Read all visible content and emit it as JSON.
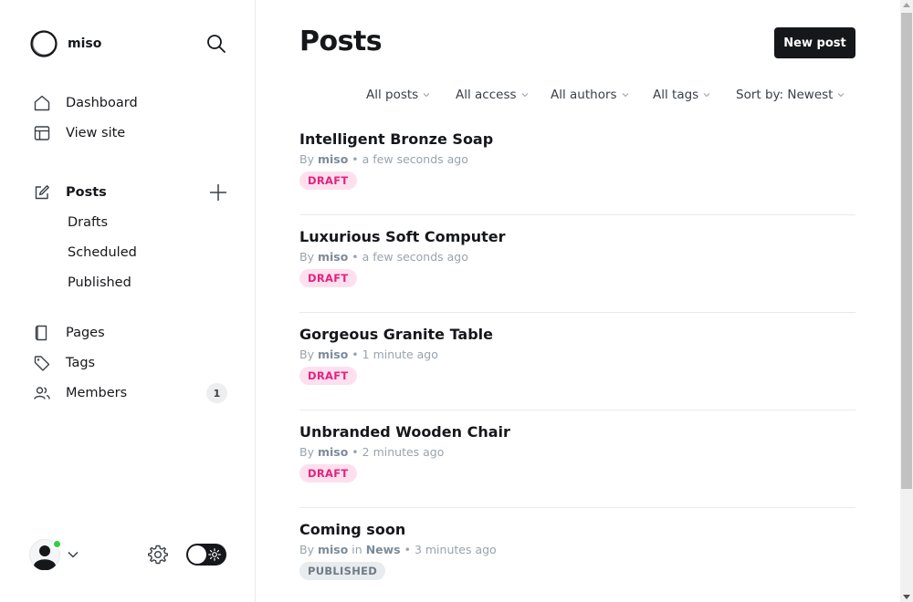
{
  "sidebar": {
    "brand_name": "miso",
    "nav": [
      {
        "label": "Dashboard",
        "icon": "house-icon"
      },
      {
        "label": "View site",
        "icon": "layout-icon"
      }
    ],
    "posts": {
      "label": "Posts",
      "icon": "pencil-square-icon",
      "subitems": [
        "Drafts",
        "Scheduled",
        "Published"
      ]
    },
    "secondary": [
      {
        "label": "Pages",
        "icon": "page-icon"
      },
      {
        "label": "Tags",
        "icon": "tag-icon"
      },
      {
        "label": "Members",
        "icon": "users-icon",
        "count": "1"
      }
    ]
  },
  "main": {
    "title": "Posts",
    "new_post_label": "New post",
    "filters": [
      "All posts",
      "All access",
      "All authors",
      "All tags",
      "Sort by: Newest"
    ],
    "posts": [
      {
        "title": "Intelligent Bronze Soap",
        "by": "By",
        "author": "miso",
        "in": "",
        "tag": "",
        "time": "• a few seconds ago",
        "status": "DRAFT"
      },
      {
        "title": "Luxurious Soft Computer",
        "by": "By",
        "author": "miso",
        "in": "",
        "tag": "",
        "time": "• a few seconds ago",
        "status": "DRAFT"
      },
      {
        "title": "Gorgeous Granite Table",
        "by": "By",
        "author": "miso",
        "in": "",
        "tag": "",
        "time": "• 1 minute ago",
        "status": "DRAFT"
      },
      {
        "title": "Unbranded Wooden Chair",
        "by": "By",
        "author": "miso",
        "in": "",
        "tag": "",
        "time": "• 2 minutes ago",
        "status": "DRAFT"
      },
      {
        "title": "Coming soon",
        "by": "By",
        "author": "miso",
        "in": "in",
        "tag": "News",
        "time": "• 3 minutes ago",
        "status": "PUBLISHED"
      }
    ]
  },
  "colors": {
    "primary": "#15171a",
    "draft_bg": "#fde0ee",
    "draft_fg": "#e3227d",
    "published_bg": "#e8ecef",
    "published_fg": "#6f7b86",
    "online": "#30cf43"
  }
}
